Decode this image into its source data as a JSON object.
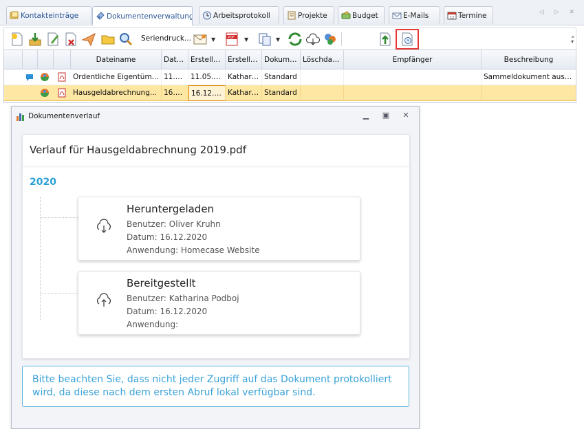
{
  "tabs": [
    {
      "label": "Kontakteinträge",
      "icon": "contacts-icon"
    },
    {
      "label": "Dokumentenverwaltung",
      "icon": "documents-icon",
      "active": true
    },
    {
      "label": "Arbeitsprotokoll",
      "icon": "clock-icon"
    },
    {
      "label": "Projekte",
      "icon": "projects-icon"
    },
    {
      "label": "Budget",
      "icon": "budget-icon"
    },
    {
      "label": "E-Mails",
      "icon": "mail-icon"
    },
    {
      "label": "Termine",
      "icon": "calendar-icon"
    }
  ],
  "toolbar": {
    "serial_label": "Seriendruck..."
  },
  "grid": {
    "columns": [
      "Dateiname",
      "Datum",
      "Erstellt a...",
      "Erstellt v...",
      "Dokume...",
      "Löschdatu...",
      "Empfänger",
      "Beschreibung"
    ],
    "rows": [
      {
        "name": "Ordentliche Eigentüm...",
        "date": "11.0...",
        "created_at": "11.05.2...",
        "created_by": "Kathari...",
        "doctype": "Standard",
        "deletion": "",
        "recipient": "",
        "description": "Sammeldokument aus P..."
      },
      {
        "name": "Hausgeldabrechnung...",
        "date": "16.1...",
        "created_at": "16.12.2...",
        "created_by": "Kathari...",
        "doctype": "Standard",
        "deletion": "",
        "recipient": "",
        "description": ""
      }
    ]
  },
  "panel": {
    "title": "Dokumentenverlauf",
    "heading": "Verlauf für Hausgeldabrechnung 2019.pdf",
    "year": "2020",
    "events": [
      {
        "title": "Heruntergeladen",
        "icon": "cloud-download-icon",
        "user": "Benutzer: Oliver Kruhn",
        "date": "Datum: 16.12.2020",
        "app": "Anwendung: Homecase Website"
      },
      {
        "title": "Bereitgestellt",
        "icon": "cloud-upload-icon",
        "user": "Benutzer: Katharina Podboj",
        "date": "Datum: 16.12.2020",
        "app": "Anwendung:"
      }
    ],
    "notice": "Bitte beachten Sie, dass nicht jeder Zugriff auf das Dokument protokolliert wird, da diese nach dem ersten Abruf lokal verfügbar sind."
  },
  "colors": {
    "accent_blue": "#2a9fd6",
    "selection": "#fde7a3",
    "highlight_red": "#e53935"
  }
}
